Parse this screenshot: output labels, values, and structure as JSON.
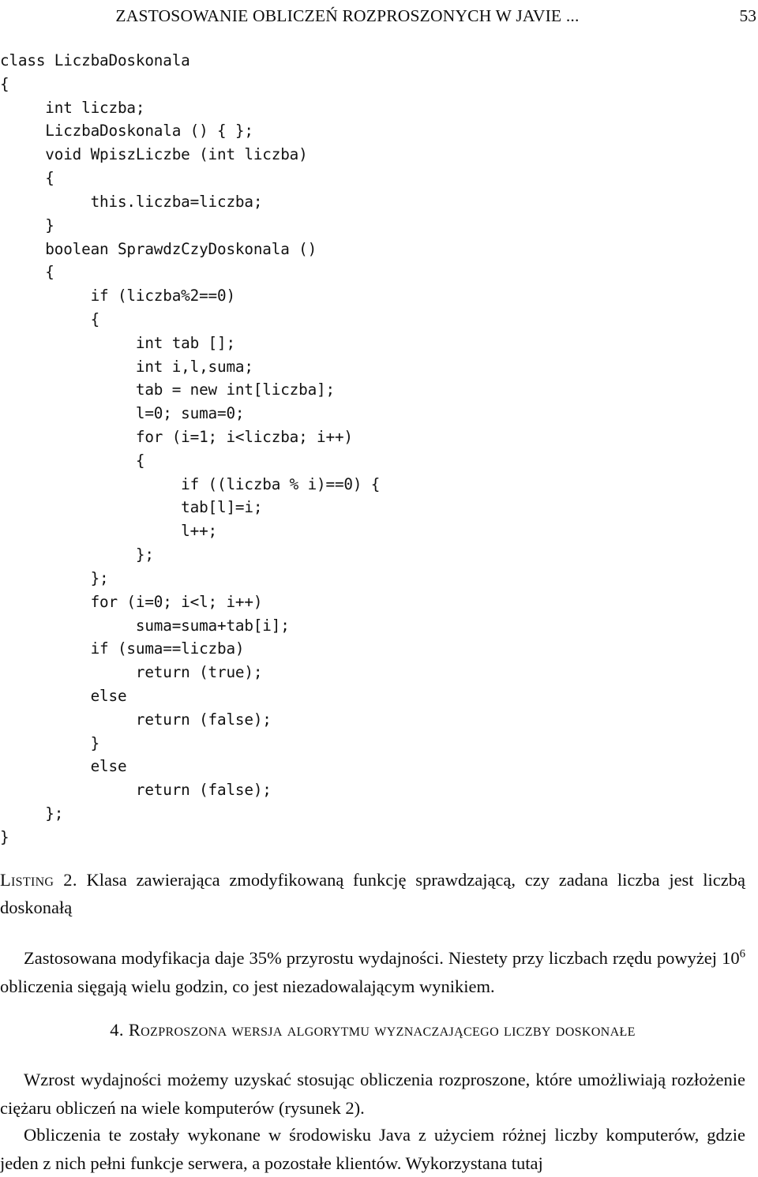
{
  "running_head": {
    "title": "ZASTOSOWANIE OBLICZEŃ ROZPROSZONYCH W JAVIE ...",
    "page_number": "53"
  },
  "code_listing": {
    "language": "java",
    "lines": [
      "class LiczbaDoskonala",
      "{",
      "     int liczba;",
      "     LiczbaDoskonala () { };",
      "     void WpiszLiczbe (int liczba)",
      "     {",
      "          this.liczba=liczba;",
      "     }",
      "     boolean SprawdzCzyDoskonala ()",
      "     {",
      "          if (liczba%2==0)",
      "          {",
      "               int tab [];",
      "               int i,l,suma;",
      "               tab = new int[liczba];",
      "               l=0; suma=0;",
      "               for (i=1; i<liczba; i++)",
      "               {",
      "                    if ((liczba % i)==0) {",
      "                    tab[l]=i;",
      "                    l++;",
      "               };",
      "          };",
      "          for (i=0; i<l; i++)",
      "               suma=suma+tab[i];",
      "          if (suma==liczba)",
      "               return (true);",
      "          else",
      "               return (false);",
      "          }",
      "          else",
      "               return (false);",
      "     };",
      "}"
    ]
  },
  "listing_caption": {
    "label": "Listing 2.",
    "text": " Klasa zawierająca zmodyfikowaną funkcję sprawdzającą, czy zadana liczba jest liczbą doskonałą"
  },
  "paragraphs": {
    "performance_part1": "Zastosowana modyfikacja daje 35% przyrostu wydajności. Niestety przy liczbach rzędu powyżej 10",
    "performance_exponent": "6",
    "performance_part2": " obliczenia sięgają wielu godzin, co jest niezadowalającym wynikiem.",
    "wzrost": "Wzrost wydajności możemy uzyskać stosując obliczenia rozproszone, które umożliwiają rozłożenie ciężaru obliczeń na wiele komputerów (rysunek 2).",
    "obliczenia": "Obliczenia te zostały wykonane w środowisku Java z użyciem różnej liczby komputerów, gdzie jeden z nich pełni funkcje serwera, a pozostałe klientów. Wykorzystana tutaj"
  },
  "section_heading": {
    "number": "4.",
    "title": "Rozproszona wersja algorytmu wyznaczającego liczby doskonałe"
  }
}
